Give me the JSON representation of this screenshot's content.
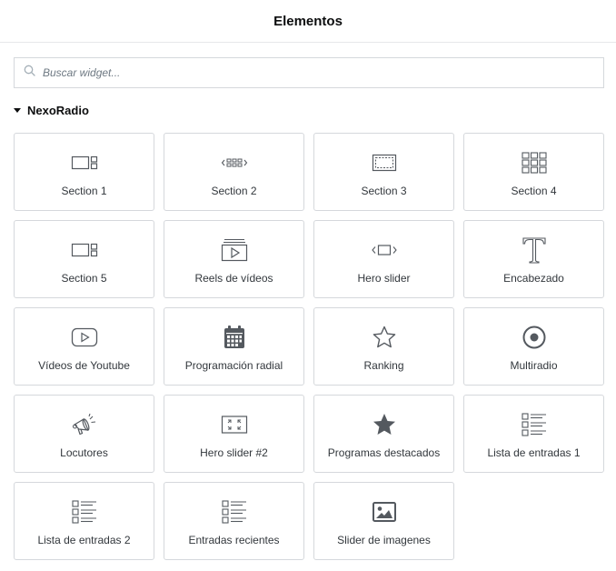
{
  "header": {
    "title": "Elementos"
  },
  "search": {
    "placeholder": "Buscar widget...",
    "icon": "search-icon"
  },
  "category": {
    "title": "NexoRadio",
    "expanded": true
  },
  "widgets": [
    {
      "label": "Section 1",
      "icon": "layout-icon"
    },
    {
      "label": "Section 2",
      "icon": "carousel-icon"
    },
    {
      "label": "Section 3",
      "icon": "frame-icon"
    },
    {
      "label": "Section 4",
      "icon": "grid-icon"
    },
    {
      "label": "Section 5",
      "icon": "layout-icon"
    },
    {
      "label": "Reels de vídeos",
      "icon": "video-reel-icon"
    },
    {
      "label": "Hero slider",
      "icon": "slider-icon"
    },
    {
      "label": "Encabezado",
      "icon": "heading-icon"
    },
    {
      "label": "Vídeos de Youtube",
      "icon": "youtube-icon"
    },
    {
      "label": "Programación radial",
      "icon": "calendar-icon"
    },
    {
      "label": "Ranking",
      "icon": "star-outline-icon"
    },
    {
      "label": "Multiradio",
      "icon": "record-icon"
    },
    {
      "label": "Locutores",
      "icon": "megaphone-icon"
    },
    {
      "label": "Hero slider #2",
      "icon": "expand-icon"
    },
    {
      "label": "Programas destacados",
      "icon": "star-filled-icon"
    },
    {
      "label": "Lista de entradas 1",
      "icon": "post-list-icon"
    },
    {
      "label": "Lista de entradas 2",
      "icon": "post-list-icon"
    },
    {
      "label": "Entradas recientes",
      "icon": "post-list-icon"
    },
    {
      "label": "Slider de imagenes",
      "icon": "image-icon"
    }
  ],
  "colors": {
    "icon": "#54595f",
    "border": "#d5d8dc",
    "text": "#32373c"
  }
}
